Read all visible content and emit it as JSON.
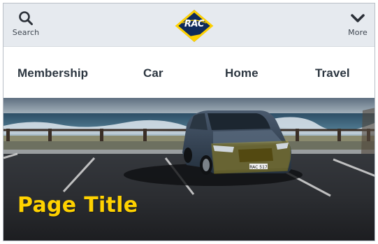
{
  "header": {
    "search_label": "Search",
    "more_label": "More",
    "logo_text": "RAC",
    "search_icon": "search-icon",
    "more_icon": "chevron-down-icon"
  },
  "nav": {
    "items": [
      {
        "label": "Membership"
      },
      {
        "label": "Car"
      },
      {
        "label": "Home"
      },
      {
        "label": "Travel"
      }
    ]
  },
  "hero": {
    "title": "Page Title",
    "plate_text": "RAC 517"
  },
  "colors": {
    "brand_navy": "#0f2b5b",
    "brand_yellow": "#ffd200",
    "topbar_bg": "#e6eaef",
    "nav_text": "#2c3640"
  }
}
